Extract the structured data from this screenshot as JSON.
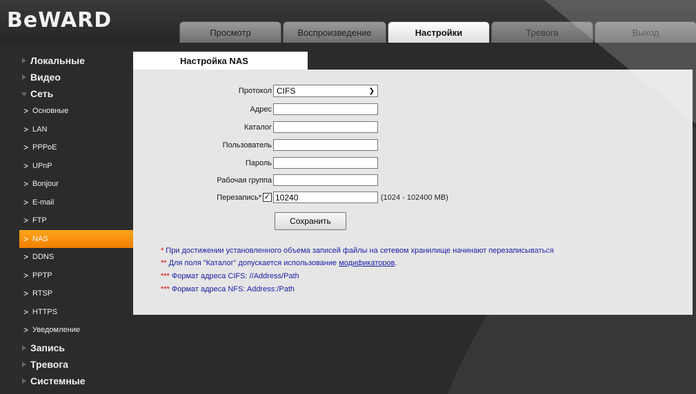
{
  "brand": {
    "logo_text": "BeWARD"
  },
  "tabs": [
    {
      "label": "Просмотр",
      "active": false
    },
    {
      "label": "Воспроизведение",
      "active": false
    },
    {
      "label": "Настройки",
      "active": true
    },
    {
      "label": "Тревога",
      "active": false
    },
    {
      "label": "Выход",
      "active": false
    }
  ],
  "sidebar": {
    "top_items": {
      "local": "Локальные",
      "video": "Видео",
      "network": "Сеть",
      "record": "Запись",
      "alarm": "Тревога",
      "system": "Системные"
    },
    "network_subitems": [
      "Основные",
      "LAN",
      "PPPoE",
      "UPnP",
      "Bonjour",
      "E-mail",
      "FTP",
      "NAS",
      "DDNS",
      "PPTP",
      "RTSP",
      "HTTPS",
      "Уведомление"
    ],
    "active_subitem": "NAS"
  },
  "page": {
    "tab_title": "Настройка NAS",
    "protocol": {
      "label": "Протокол",
      "value": "CIFS"
    },
    "address": {
      "label": "Адрес",
      "value": ""
    },
    "catalog": {
      "label": "Каталог",
      "value": ""
    },
    "user": {
      "label": "Пользователь",
      "value": ""
    },
    "password": {
      "label": "Пароль",
      "value": ""
    },
    "workgroup": {
      "label": "Рабочая группа",
      "value": ""
    },
    "overwrite": {
      "label": "Перезапись*",
      "checked": true,
      "value": "10240",
      "range_hint": "(1024 - 102400 MB)"
    },
    "save_label": "Сохранить",
    "notes": {
      "n1_star": "*",
      "n1_text": "При достижении установленного объема записей файлы на сетевом хранилище начинают перезаписываться",
      "n2_star": "**",
      "n2_text_before": "Для поля \"Каталог\" допускается использование ",
      "n2_link": "модификаторов",
      "n2_text_after": ".",
      "n3_star": "***",
      "n3_text": "Формат адреса CIFS: //Address/Path",
      "n4_star": "***",
      "n4_text": "Формат адреса NFS: Address:/Path"
    }
  },
  "colors": {
    "active_orange": "#f5900a",
    "note_blue": "#1a1aa6",
    "star_red": "#d00000"
  }
}
